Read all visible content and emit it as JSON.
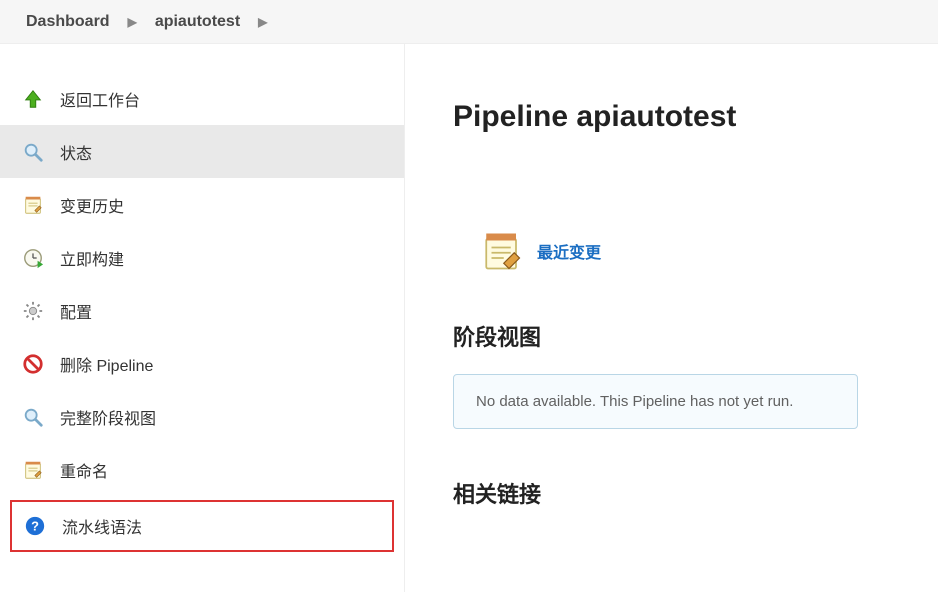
{
  "breadcrumb": {
    "dashboard": "Dashboard",
    "project": "apiautotest"
  },
  "sidebar": {
    "back": "返回工作台",
    "status": "状态",
    "changes": "变更历史",
    "build_now": "立即构建",
    "configure": "配置",
    "delete_pipeline": "删除 Pipeline",
    "full_stage_view": "完整阶段视图",
    "rename": "重命名",
    "pipeline_syntax": "流水线语法"
  },
  "main": {
    "title": "Pipeline apiautotest",
    "recent_changes": "最近变更",
    "stage_view_heading": "阶段视图",
    "no_data_msg": "No data available. This Pipeline has not yet run.",
    "related_links_heading": "相关链接"
  }
}
